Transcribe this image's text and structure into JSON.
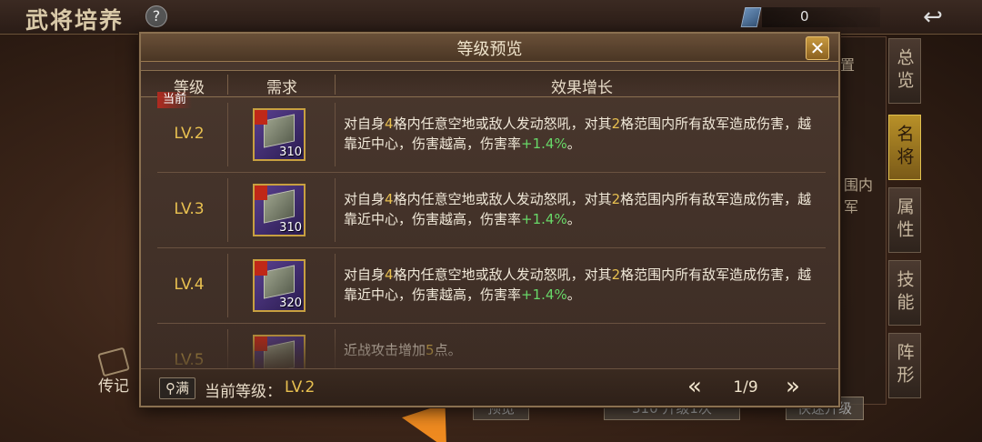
{
  "background": {
    "title": "武将培养",
    "help_icon": "?",
    "currency_value": "0",
    "back_icon": "↩",
    "right_tabs": [
      {
        "label": "总览",
        "active": false
      },
      {
        "label": "名将",
        "active": true
      },
      {
        "label": "属性",
        "active": false
      },
      {
        "label": "技能",
        "active": false
      },
      {
        "label": "阵形",
        "active": false
      }
    ],
    "partial_texts": [
      "置",
      "围内",
      "军"
    ],
    "bio_label": "传记",
    "bottom_buttons": [
      "预览",
      "310  升级1次",
      "快速升级"
    ]
  },
  "modal": {
    "title": "等级预览",
    "close_icon": "✕",
    "columns": [
      "等级",
      "需求",
      "效果增长"
    ],
    "current_tag": "当前",
    "rows": [
      {
        "level": "LV.2",
        "count": "310",
        "current": true,
        "effect": [
          [
            "t",
            "对自身"
          ],
          [
            "g",
            "4"
          ],
          [
            "t",
            "格内任意空地或敌人发动怒吼，对其"
          ],
          [
            "g",
            "2"
          ],
          [
            "t",
            "格范围内所有敌军造成伤害，越靠近中心，伤害越高，伤害率"
          ],
          [
            "n",
            "+1.4%"
          ],
          [
            "t",
            "。"
          ]
        ]
      },
      {
        "level": "LV.3",
        "count": "310",
        "current": false,
        "effect": [
          [
            "t",
            "对自身"
          ],
          [
            "g",
            "4"
          ],
          [
            "t",
            "格内任意空地或敌人发动怒吼，对其"
          ],
          [
            "g",
            "2"
          ],
          [
            "t",
            "格范围内所有敌军造成伤害，越靠近中心，伤害越高，伤害率"
          ],
          [
            "n",
            "+1.4%"
          ],
          [
            "t",
            "。"
          ]
        ]
      },
      {
        "level": "LV.4",
        "count": "320",
        "current": false,
        "effect": [
          [
            "t",
            "对自身"
          ],
          [
            "g",
            "4"
          ],
          [
            "t",
            "格内任意空地或敌人发动怒吼，对其"
          ],
          [
            "g",
            "2"
          ],
          [
            "t",
            "格范围内所有敌军造成伤害，越靠近中心，伤害越高，伤害率"
          ],
          [
            "n",
            "+1.4%"
          ],
          [
            "t",
            "。"
          ]
        ]
      },
      {
        "level": "LV.5",
        "count": "",
        "current": false,
        "effect": [
          [
            "t",
            "近战攻击增加"
          ],
          [
            "g",
            "5"
          ],
          [
            "t",
            "点。"
          ]
        ]
      }
    ],
    "footer": {
      "max_label": "满",
      "current_level_label": "当前等级：",
      "current_level_value": "LV.2",
      "prev_icon": "«",
      "next_icon": "»",
      "page": "1/9"
    }
  },
  "colors": {
    "gold": "#e8c050",
    "green": "#68d868",
    "tab_active": "#b89028"
  }
}
